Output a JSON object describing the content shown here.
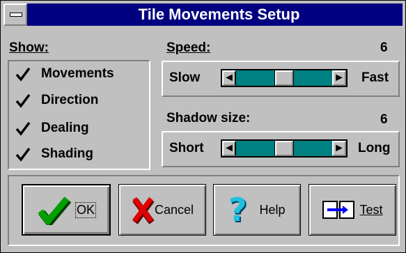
{
  "window": {
    "title": "Tile Movements Setup"
  },
  "show": {
    "heading": "Show:",
    "items": [
      {
        "label": "Movements",
        "checked": true
      },
      {
        "label": "Direction",
        "checked": true
      },
      {
        "label": "Dealing",
        "checked": true
      },
      {
        "label": "Shading",
        "checked": true
      }
    ]
  },
  "speed": {
    "heading": "Speed:",
    "value": "6",
    "min_label": "Slow",
    "max_label": "Fast",
    "position_fraction": 0.5
  },
  "shadow": {
    "heading": "Shadow size:",
    "value": "6",
    "min_label": "Short",
    "max_label": "Long",
    "position_fraction": 0.5
  },
  "buttons": {
    "ok": "OK",
    "cancel": "Cancel",
    "help": "Help",
    "test": "Test"
  },
  "colors": {
    "titlebar": "#000080",
    "scroll_track": "#008080",
    "ok_check": "#00a000",
    "cancel_x": "#e00000",
    "help_q": "#00a0c0",
    "test_arrow": "#0000ff"
  }
}
